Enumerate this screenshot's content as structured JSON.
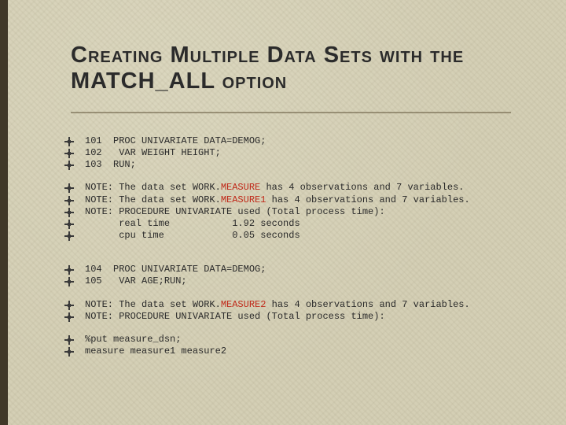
{
  "title": "Creating Multiple Data Sets with the MATCH_ALL option",
  "lines": {
    "l1": "101  PROC UNIVARIATE DATA=DEMOG;",
    "l2": "102   VAR WEIGHT HEIGHT;",
    "l3": "103  RUN;",
    "n1a": "NOTE: The data set WORK.",
    "n1b": "MEASURE",
    "n1c": " has 4 observations and 7 variables.",
    "n2a": "NOTE: The data set WORK.",
    "n2b": "MEASURE1",
    "n2c": " has 4 observations and 7 variables.",
    "n3": "NOTE: PROCEDURE UNIVARIATE used (Total process time):",
    "n4": "      real time           1.92 seconds",
    "n5": "      cpu time            0.05 seconds",
    "l4": "104  PROC UNIVARIATE DATA=DEMOG;",
    "l5": "105   VAR AGE;RUN;",
    "n6a": "NOTE: The data set WORK.",
    "n6b": "MEASURE2",
    "n6c": " has 4 observations and 7 variables.",
    "n7": "NOTE: PROCEDURE UNIVARIATE used (Total process time):",
    "p1": "%put measure_dsn;",
    "p2": "measure measure1 measure2"
  }
}
